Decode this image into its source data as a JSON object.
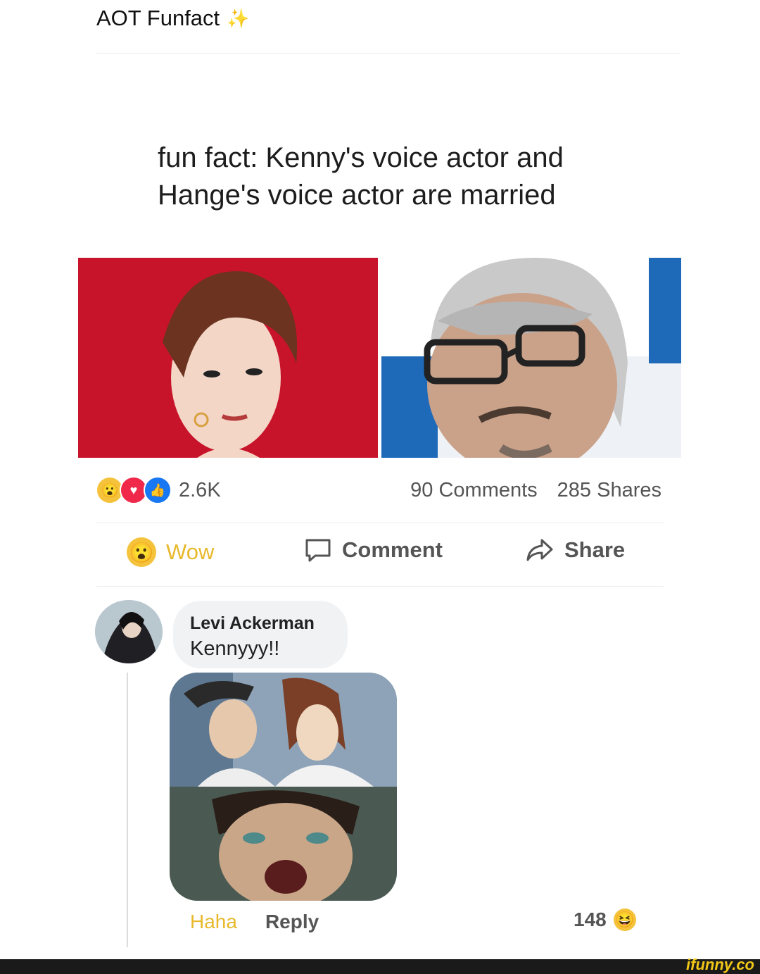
{
  "header": {
    "title": "AOT Funfact",
    "sparkle_icon": "sparkles-icon"
  },
  "post": {
    "text_line1": "fun fact: Kenny's voice actor and",
    "text_line2": "Hange's voice actor are married"
  },
  "stats": {
    "reaction_count": "2.6K",
    "comments": "90 Comments",
    "shares": "285 Shares"
  },
  "actions": {
    "wow": "Wow",
    "comment": "Comment",
    "share": "Share"
  },
  "comment": {
    "author": "Levi Ackerman",
    "text": "Kennyyy!!",
    "haha": "Haha",
    "reply": "Reply",
    "count": "148"
  },
  "watermark": "ifunny.co",
  "colors": {
    "wow_yellow": "#f5c33b",
    "haha_yellow": "#e8b92c",
    "like_blue": "#1877f2",
    "love_red": "#f0284a",
    "photo_red": "#c8142a"
  }
}
